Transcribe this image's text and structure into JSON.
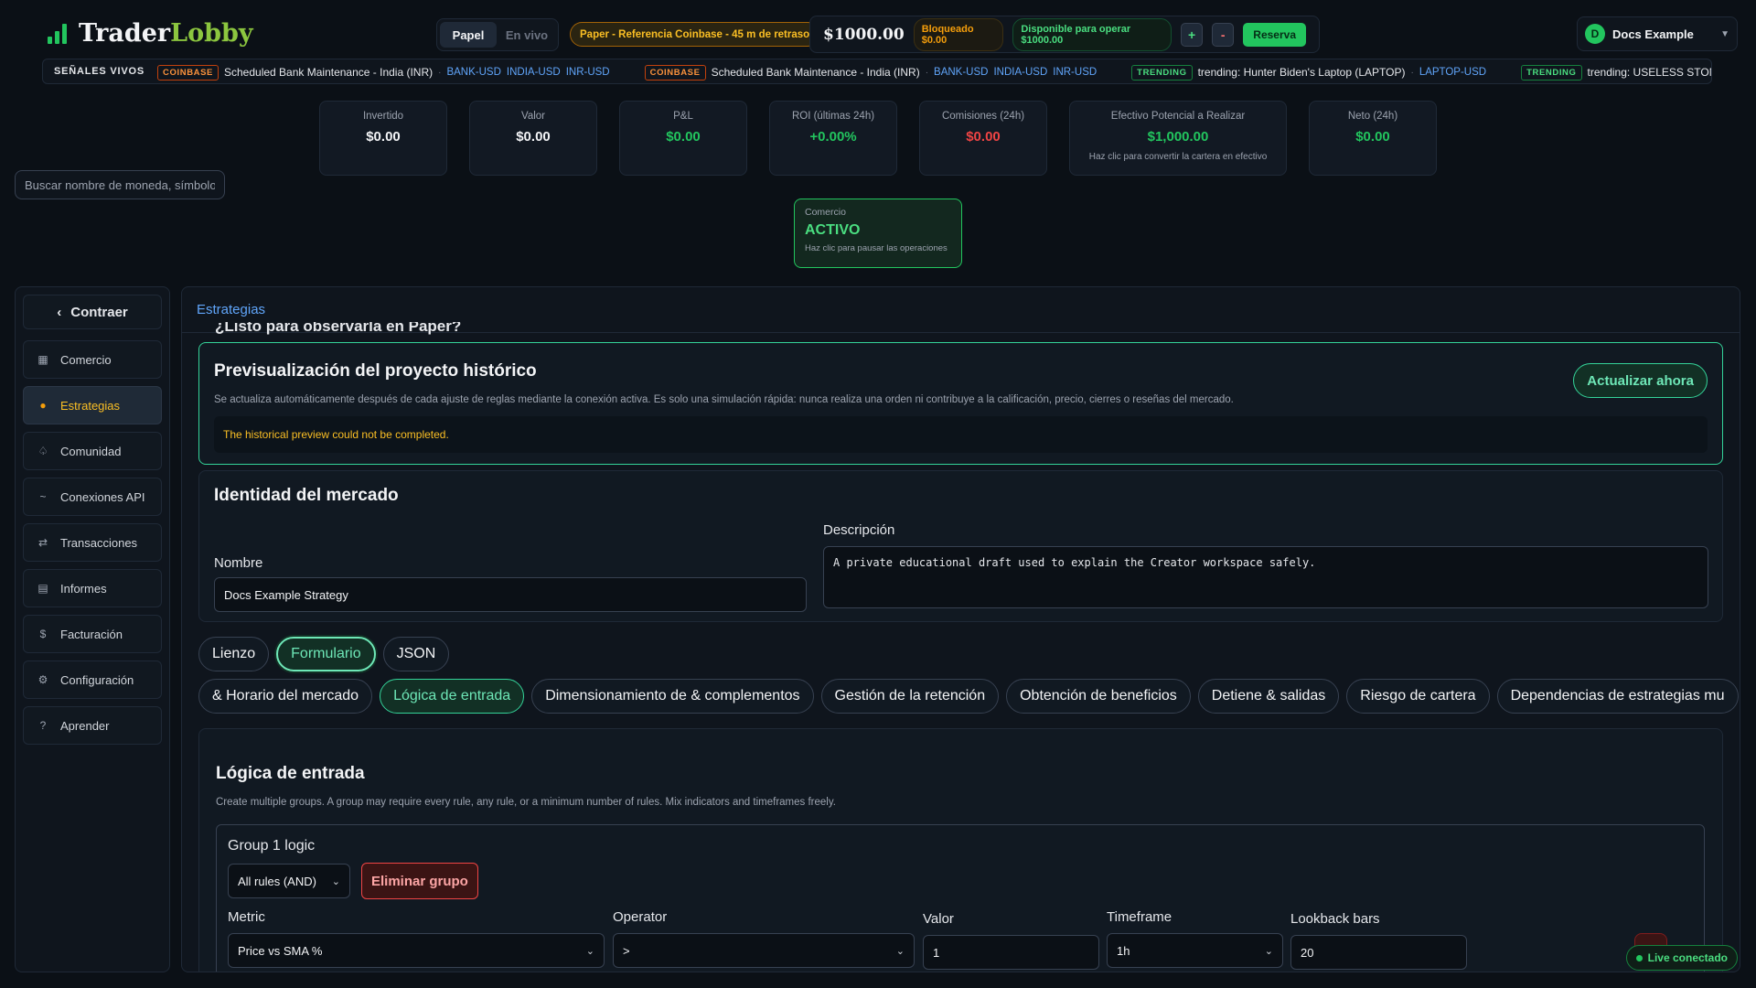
{
  "header": {
    "logo_part1": "Trader",
    "logo_part2": "Lobby",
    "mode_paper": "Papel",
    "mode_live": "En vivo",
    "paper_reference": "Paper - Referencia Coinbase - 45 m de retraso",
    "balance": "$1000.00",
    "blocked": "Bloqueado $0.00",
    "available": "Disponible para operar $1000.00",
    "plus": "+",
    "minus": "-",
    "reserve": "Reserva",
    "user_initial": "D",
    "user_name": "Docs Example"
  },
  "ticker": {
    "label": "SEÑALES VIVOS",
    "items": [
      {
        "badge": "COINBASE",
        "text": "Scheduled Bank Maintenance - India (INR)",
        "symbols": [
          "BANK-USD",
          "INDIA-USD",
          "INR-USD"
        ]
      },
      {
        "badge": "COINBASE",
        "text": "Scheduled Bank Maintenance - India (INR)",
        "symbols": [
          "BANK-USD",
          "INDIA-USD",
          "INR-USD"
        ]
      },
      {
        "badge": "TRENDING",
        "text": "trending: Hunter Biden's Laptop (LAPTOP)",
        "symbols": [
          "LAPTOP-USD"
        ]
      },
      {
        "badge": "TRENDING",
        "text": "trending: USELESS STONK (STON",
        "symbols": []
      }
    ]
  },
  "stats": [
    {
      "label": "Invertido",
      "value": "$0.00",
      "tone": "white"
    },
    {
      "label": "Valor",
      "value": "$0.00",
      "tone": "white"
    },
    {
      "label": "P&L",
      "value": "$0.00",
      "tone": "green"
    },
    {
      "label": "ROI (últimas 24h)",
      "value": "+0.00%",
      "tone": "green"
    },
    {
      "label": "Comisiones (24h)",
      "value": "$0.00",
      "tone": "red"
    },
    {
      "label": "Efectivo Potencial a Realizar",
      "value": "$1,000.00",
      "tone": "green",
      "note": "Haz clic para convertir la cartera en efectivo"
    },
    {
      "label": "Neto (24h)",
      "value": "$0.00",
      "tone": "green"
    }
  ],
  "search": {
    "placeholder": "Buscar nombre de moneda, símbolo"
  },
  "trade": {
    "label": "Comercio",
    "state": "ACTIVO",
    "note": "Haz clic para pausar las operaciones"
  },
  "sidebar": {
    "collapse": "Contraer",
    "items": [
      {
        "label": "Comercio",
        "icon": "▦",
        "active": false
      },
      {
        "label": "Estrategias",
        "icon": "●",
        "active": true
      },
      {
        "label": "Comunidad",
        "icon": "♤",
        "active": false
      },
      {
        "label": "Conexiones API",
        "icon": "~",
        "active": false
      },
      {
        "label": "Transacciones",
        "icon": "⇄",
        "active": false
      },
      {
        "label": "Informes",
        "icon": "▤",
        "active": false
      },
      {
        "label": "Facturación",
        "icon": "$",
        "active": false
      },
      {
        "label": "Configuración",
        "icon": "⚙",
        "active": false
      },
      {
        "label": "Aprender",
        "icon": "?",
        "active": false
      }
    ]
  },
  "main": {
    "header": "Estrategias",
    "cut_heading": "¿Listo para observarla en Paper?",
    "preview": {
      "title": "Previsualización del proyecto histórico",
      "description": "Se actualiza automáticamente después de cada ajuste de reglas mediante la conexión activa. Es solo una simulación rápida: nunca realiza una orden ni contribuye a la calificación, precio, cierres o reseñas del mercado.",
      "error": "The historical preview could not be completed.",
      "refresh": "Actualizar ahora"
    },
    "identity": {
      "title": "Identidad del mercado",
      "name_label": "Nombre",
      "name_value": "Docs Example Strategy",
      "desc_label": "Descripción",
      "desc_value": "A private educational draft used to explain the Creator workspace safely."
    },
    "view_tabs": [
      "Lienzo",
      "Formulario",
      "JSON"
    ],
    "section_tabs": [
      "& Horario del mercado",
      "Lógica de entrada",
      "Dimensionamiento de & complementos",
      "Gestión de la retención",
      "Obtención de beneficios",
      "Detiene & salidas",
      "Riesgo de cartera",
      "Dependencias de estrategias mu"
    ],
    "entry": {
      "title": "Lógica de entrada",
      "description": "Create multiple groups. A group may require every rule, any rule, or a minimum number of rules. Mix indicators and timeframes freely.",
      "group_title": "Group 1 logic",
      "group_mode": "All rules (AND)",
      "delete_group": "Eliminar grupo",
      "metric_label": "Metric",
      "metric_value": "Price vs SMA %",
      "operator_label": "Operator",
      "operator_value": ">",
      "value_label": "Valor",
      "value_value": "1",
      "timeframe_label": "Timeframe",
      "timeframe_value": "1h",
      "lookback_label": "Lookback bars",
      "lookback_value": "20"
    }
  },
  "status": {
    "live": "Live conectado"
  },
  "colors": {
    "accent_green": "#22c55e",
    "accent_amber": "#fbbf24",
    "link_blue": "#60a5fa",
    "danger": "#ef4444"
  }
}
